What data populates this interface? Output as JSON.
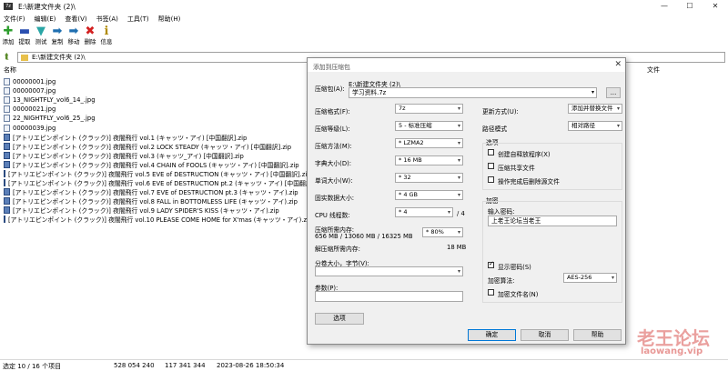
{
  "window": {
    "title": "E:\\新建文件夹 (2)\\",
    "app_icon": "7z"
  },
  "menu": [
    "文件(F)",
    "编辑(E)",
    "查看(V)",
    "书签(A)",
    "工具(T)",
    "帮助(H)"
  ],
  "toolbar": [
    {
      "label": "添加",
      "icon": "plus-icon",
      "glyph": "✚",
      "color": "#2e9e2e"
    },
    {
      "label": "提取",
      "icon": "minus-icon",
      "glyph": "▬",
      "color": "#2b4fb0"
    },
    {
      "label": "测试",
      "icon": "check-icon",
      "glyph": "▼",
      "color": "#2aa6a6"
    },
    {
      "label": "复制",
      "icon": "copy-arrow-icon",
      "glyph": "➡",
      "color": "#1f6fb0"
    },
    {
      "label": "移动",
      "icon": "move-arrow-icon",
      "glyph": "➡",
      "color": "#1f6fb0"
    },
    {
      "label": "删除",
      "icon": "delete-icon",
      "glyph": "✖",
      "color": "#d32020"
    },
    {
      "label": "信息",
      "icon": "info-icon",
      "glyph": "ℹ",
      "color": "#b08a00"
    }
  ],
  "address": {
    "path": "E:\\新建文件夹 (2)\\"
  },
  "columns": {
    "name": "名称",
    "right": "文件"
  },
  "files": [
    {
      "name": "00000001.jpg",
      "type": "jpg"
    },
    {
      "name": "00000007.jpg",
      "type": "jpg"
    },
    {
      "name": "13_NIGHTFLY_vol6_14_.jpg",
      "type": "jpg"
    },
    {
      "name": "00000021.jpg",
      "type": "jpg"
    },
    {
      "name": "22_NIGHTFLY_vol6_25_.jpg",
      "type": "jpg"
    },
    {
      "name": "00000039.jpg",
      "type": "jpg"
    },
    {
      "name": "[アトリエピンポイント (クラック)] 夜闇飛行 vol.1 (キャッツ・アイ) [中国翻訳].zip",
      "type": "zip"
    },
    {
      "name": "[アトリエピンポイント (クラック)] 夜闇飛行 vol.2 LOCK STEADY (キャッツ・アイ) [中国翻訳].zip",
      "type": "zip"
    },
    {
      "name": "[アトリエピンポイント (クラック)] 夜闇飛行 vol.3 (キャッツ_アイ) [中国翻訳].zip",
      "type": "zip"
    },
    {
      "name": "[アトリエピンポイント (クラック)] 夜闇飛行 vol.4 CHAIN of FOOLS (キャッツ・アイ) [中国翻訳].zip",
      "type": "zip"
    },
    {
      "name": "[アトリエピンポイント (クラック)] 夜闇飛行 vol.5 EVE of DESTRUCTION (キャッツ・アイ) [中国翻訳].zip",
      "type": "zip"
    },
    {
      "name": "[アトリエピンポイント (クラック)] 夜闇飛行 vol.6 EVE of DESTRUCTION pt.2 (キャッツ・アイ) [中国翻訳]",
      "type": "zip"
    },
    {
      "name": "[アトリエピンポイント (クラック)] 夜闇飛行 vol.7 EVE of DESTRUCTION pt.3 (キャッツ・アイ).zip",
      "type": "zip"
    },
    {
      "name": "[アトリエピンポイント (クラック)] 夜闇飛行 vol.8 FALL in BOTTOMLESS LIFE (キャッツ・アイ).zip",
      "type": "zip"
    },
    {
      "name": "[アトリエピンポイント (クラック)] 夜闇飛行 vol.9 LADY SPIDER'S KISS (キャッツ・アイ).zip",
      "type": "zip"
    },
    {
      "name": "[アトリエピンポイント (クラック)] 夜闇飛行 vol.10 PLEASE COME HOME for X'mas (キャッツ・アイ).zip",
      "type": "zip"
    }
  ],
  "status": {
    "selection": "选定 10 / 16 个项目",
    "size": "528 054 240",
    "packed": "117 341 344",
    "modified": "2023-08-26 18:50:34"
  },
  "dialog": {
    "title": "添加到压缩包",
    "archive_label": "压缩包(A):",
    "archive_dir": "E:\\新建文件夹 (2)\\",
    "archive_name": "学习资料.7z",
    "browse": "...",
    "format_label": "压缩格式(F):",
    "format_value": "7z",
    "level_label": "压缩等级(L):",
    "level_value": "5 - 标准压缩",
    "method_label": "压缩方法(M):",
    "method_value": "* LZMA2",
    "dict_label": "字典大小(D):",
    "dict_value": "* 16 MB",
    "word_label": "单词大小(W):",
    "word_value": "* 32",
    "solid_label": "固实数据大小:",
    "solid_value": "* 4 GB",
    "cpu_label": "CPU 线程数:",
    "cpu_value": "* 4",
    "cpu_max": "/ 4",
    "mem_label": "压缩所需内存:",
    "mem_detail": "656 MB / 13060 MB / 16325 MB",
    "mem_pct": "* 80%",
    "demem_label": "解压缩所需内存:",
    "demem_value": "18 MB",
    "split_label": "分卷大小，字节(V):",
    "params_label": "参数(P):",
    "options_btn": "选项",
    "update_label": "更新方式(U):",
    "update_value": "添加并替换文件",
    "path_label": "路径模式",
    "path_value": "相对路径",
    "opt_group": "选项",
    "opt_sfx": "创建自释放程序(X)",
    "opt_shared": "压缩共享文件",
    "opt_delete": "操作完成后删除源文件",
    "enc_group": "加密",
    "pwd_label": "输入密码:",
    "pwd_value": "上老王论坛当老王",
    "show_pwd": "显示密码(S)",
    "enc_method_label": "加密算法:",
    "enc_method_value": "AES-256",
    "enc_names": "加密文件名(N)",
    "ok": "确定",
    "cancel": "取消",
    "help": "帮助"
  },
  "watermark": {
    "cn": "老王论坛",
    "en": "laowang.vip"
  }
}
